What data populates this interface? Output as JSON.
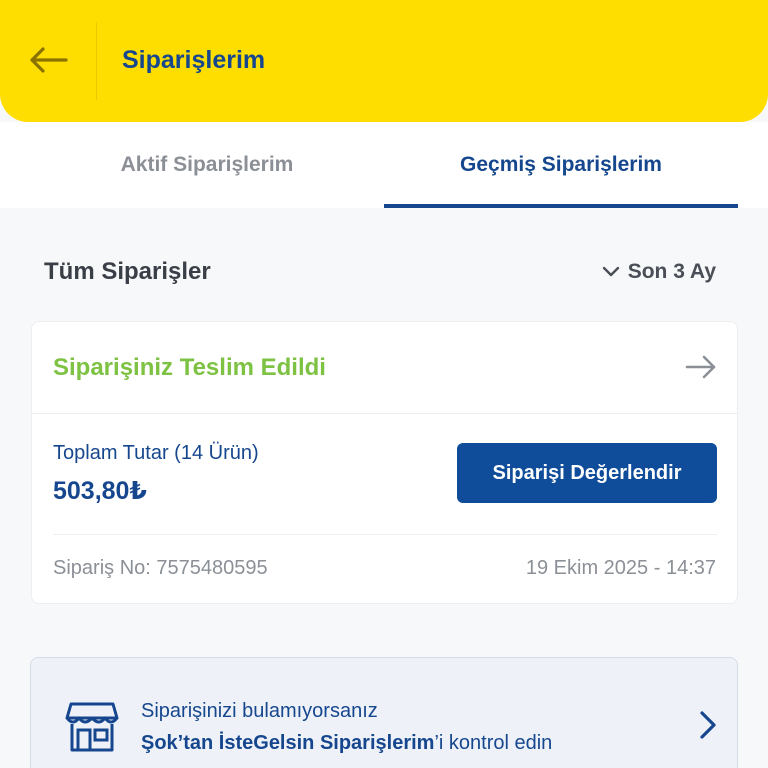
{
  "header": {
    "title": "Siparişlerim"
  },
  "tabs": [
    {
      "label": "Aktif Siparişlerim",
      "active": false
    },
    {
      "label": "Geçmiş Siparişlerim",
      "active": true
    }
  ],
  "filter": {
    "title": "Tüm Siparişler",
    "period_label": "Son 3 Ay"
  },
  "order": {
    "status": "Siparişiniz Teslim Edildi",
    "total_label": "Toplam Tutar (14 Ürün)",
    "total_value": "503,80₺",
    "rate_button": "Siparişi Değerlendir",
    "order_no": "Sipariş No: 7575480595",
    "date": "19 Ekim 2025 - 14:37"
  },
  "help": {
    "line1": "Siparişinizi bulamıyorsanız",
    "line2_bold": "Şok’tan İsteGelsin Siparişlerim",
    "line2_rest": "’i kontrol edin"
  },
  "colors": {
    "header_bg": "#fedd00",
    "primary_blue": "#16478e",
    "button_blue": "#0f4c9a",
    "status_green": "#7dc242"
  },
  "icons": [
    "arrow-left-icon",
    "chevron-down-icon",
    "arrow-right-icon",
    "store-icon",
    "chevron-right-icon"
  ]
}
